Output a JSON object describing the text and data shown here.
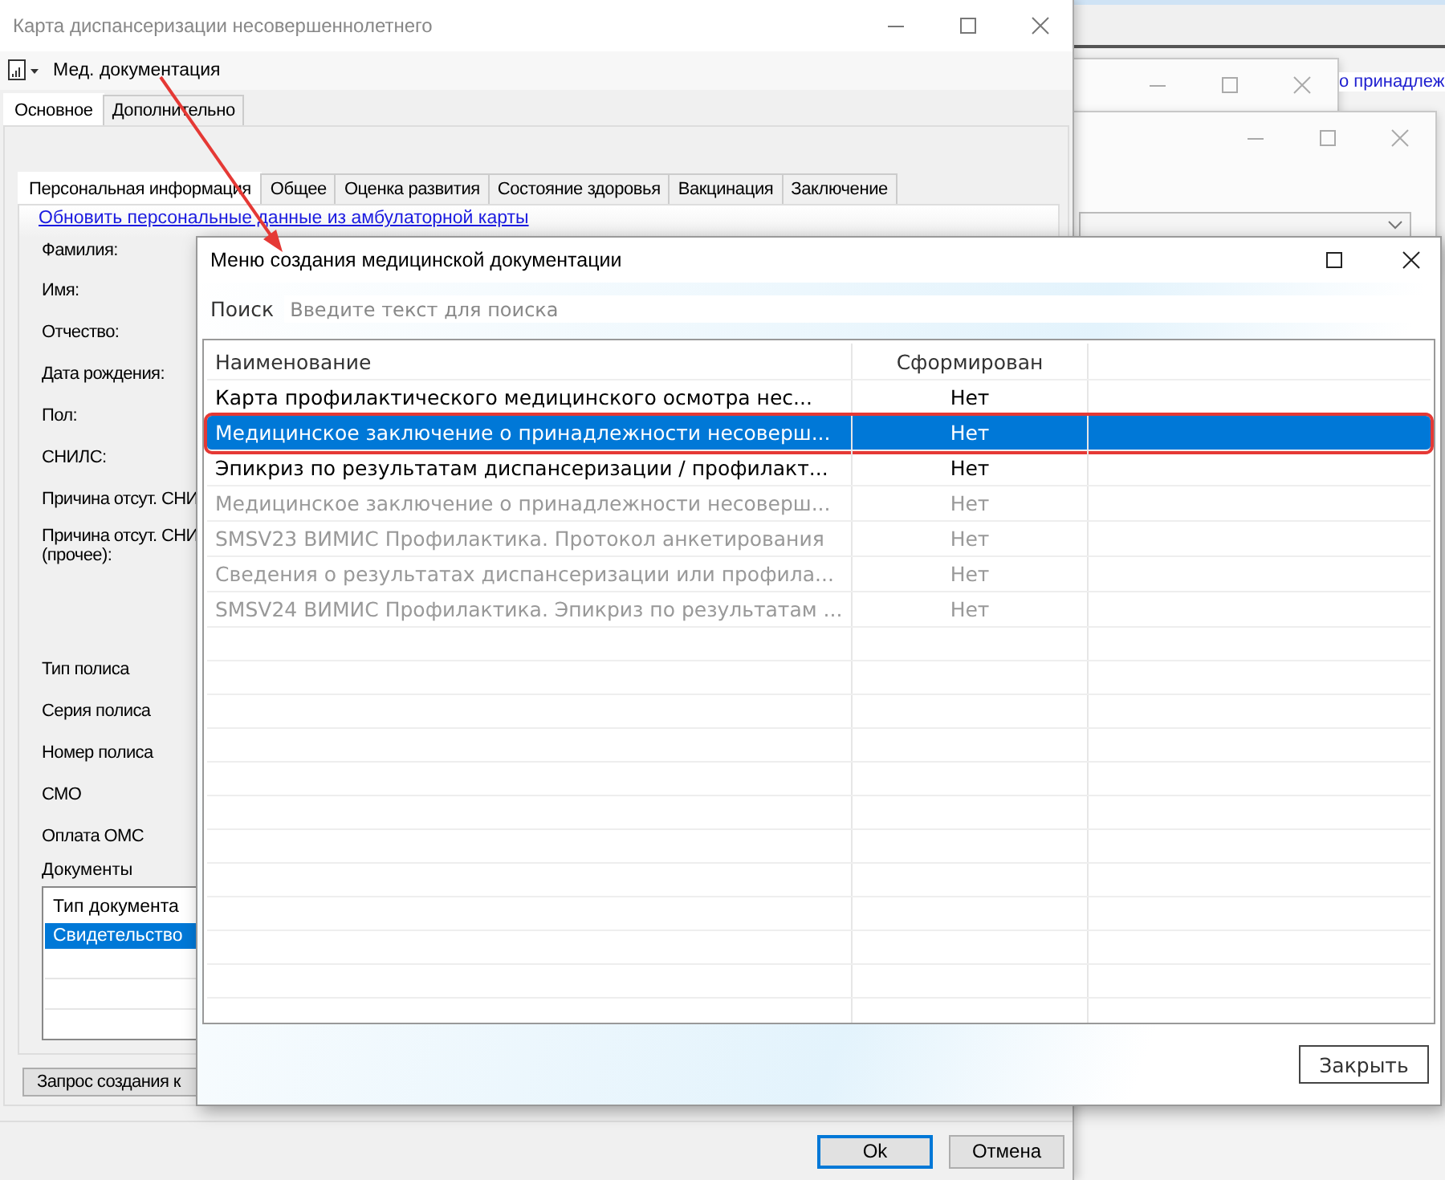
{
  "background_window": {
    "link": "о принадлеж"
  },
  "main_window": {
    "title": "Карта диспансеризации несовершеннолетнего",
    "toolbar_menu": "Мед. документация",
    "tabs": [
      {
        "label": "Основное",
        "selected": true
      },
      {
        "label": "Дополнительно",
        "selected": false
      }
    ],
    "inner_tabs": [
      {
        "label": "Персональная информация",
        "selected": true
      },
      {
        "label": "Общее",
        "selected": false
      },
      {
        "label": "Оценка развития",
        "selected": false
      },
      {
        "label": "Состояние здоровья",
        "selected": false
      },
      {
        "label": "Вакцинация",
        "selected": false
      },
      {
        "label": "Заключение",
        "selected": false
      }
    ],
    "refresh_link": "Обновить персональные данные из амбулаторной карты",
    "fields": [
      "Фамилия:",
      "Имя:",
      "Отчество:",
      "Дата рождения:",
      "Пол:",
      "СНИЛС:",
      "Причина отсут. СНИ",
      "Причина отсут. СНИ\n(прочее):",
      "Тип полиса",
      "Серия полиса",
      "Номер полиса",
      "СМО",
      "Оплата ОМС"
    ],
    "documents": {
      "label": "Документы",
      "column": "Тип документа",
      "rows": [
        {
          "cell": "Свидетельство",
          "selected": true
        }
      ]
    },
    "request_button": "Запрос создания к",
    "buttons": [
      {
        "label": "Ok",
        "focused": true
      },
      {
        "label": "Отмена",
        "focused": false
      }
    ]
  },
  "dialog": {
    "title": "Меню создания медицинской документации",
    "search": {
      "label": "Поиск",
      "placeholder": "Введите текст для поиска"
    },
    "columns": [
      "Наименование",
      "Сформирован"
    ],
    "rows": [
      {
        "name": "Карта профилактического медицинского осмотра нес...",
        "status": "Нет",
        "selected": false,
        "disabled": false,
        "highlighted": false
      },
      {
        "name": "Медицинское заключение о принадлежности несоверш...",
        "status": "Нет",
        "selected": true,
        "disabled": false,
        "highlighted": true
      },
      {
        "name": "Эпикриз по результатам диспансеризации / профилакт...",
        "status": "Нет",
        "selected": false,
        "disabled": false,
        "highlighted": false
      },
      {
        "name": "Медицинское заключение о принадлежности несоверш...",
        "status": "Нет",
        "selected": false,
        "disabled": true,
        "highlighted": false
      },
      {
        "name": "SMSV23 ВИМИС Профилактика. Протокол анкетирования",
        "status": "Нет",
        "selected": false,
        "disabled": true,
        "highlighted": false
      },
      {
        "name": "Сведения о результатах диспансеризации или профила...",
        "status": "Нет",
        "selected": false,
        "disabled": true,
        "highlighted": false
      },
      {
        "name": "SMSV24 ВИМИС Профилактика. Эпикриз по результатам ...",
        "status": "Нет",
        "selected": false,
        "disabled": true,
        "highlighted": false
      }
    ],
    "close_button": "Закрыть"
  }
}
